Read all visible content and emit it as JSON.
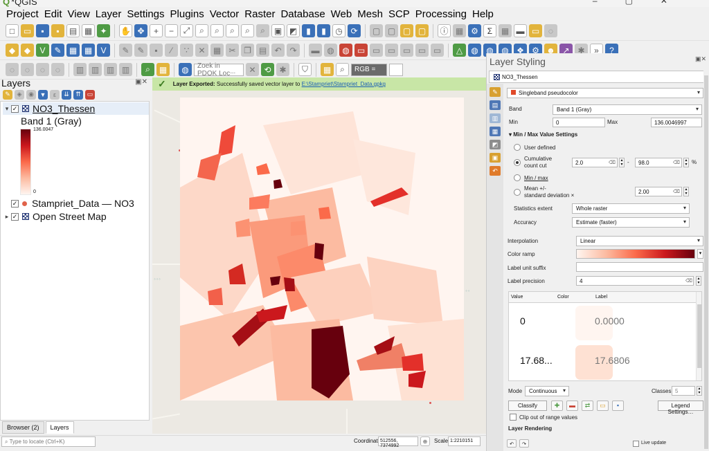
{
  "window": {
    "title": "*QGIS"
  },
  "menu": [
    "Project",
    "Edit",
    "View",
    "Layer",
    "Settings",
    "Plugins",
    "Vector",
    "Raster",
    "Database",
    "Web",
    "Mesh",
    "SCP",
    "Processing",
    "Help"
  ],
  "toolbar": {
    "pdok_placeholder": "Zoek in PDOK Locᐧᐧᐧ",
    "rgb_label": "RGB ="
  },
  "layers_panel": {
    "title": "Layers",
    "items": [
      {
        "label": "NO3_Thessen",
        "checked": "✓"
      },
      {
        "label": "Stampriet_Data — NO3",
        "checked": "✓"
      },
      {
        "label": "Open Street Map",
        "checked": "✓"
      }
    ],
    "legend": {
      "band": "Band 1 (Gray)",
      "max": "136.0047",
      "min": "0"
    }
  },
  "message": {
    "bold": "Layer Exported:",
    "text": "Successfully saved vector layer to",
    "link": "E:\\Stampriet\\Stampriet_Data.gpkg"
  },
  "bottom_tabs": [
    "Browser (2)",
    "Layers"
  ],
  "status": {
    "locate_placeholder": "Type to locate (Ctrl+K)",
    "coord_label": "Coordinate",
    "coord_value": "512556, 7374992",
    "scale_label": "Scale",
    "scale_value": "1:2210151"
  },
  "styling": {
    "title": "Layer Styling",
    "layer": "NO3_Thessen",
    "renderer": "Singleband pseudocolor",
    "band_label": "Band",
    "band_value": "Band 1 (Gray)",
    "min_label": "Min",
    "min_value": "0",
    "max_label": "Max",
    "max_value": "136.0046997",
    "minmax_title": "Min / Max Value Settings",
    "user_defined": "User defined",
    "cumulative": "Cumulative\ncount cut",
    "cum_low": "2.0",
    "cum_high": "98.0",
    "cum_unit": "%",
    "minmax": "Min / max",
    "meansd": "Mean +/-\nstandard deviation ×",
    "meansd_value": "2.00",
    "stats_extent_label": "Statistics extent",
    "stats_extent_value": "Whole raster",
    "accuracy_label": "Accuracy",
    "accuracy_value": "Estimate (faster)",
    "interp_label": "Interpolation",
    "interp_value": "Linear",
    "ramp_label": "Color ramp",
    "suffix_label": "Label unit suffix",
    "precision_label": "Label precision",
    "precision_value": "4",
    "table_headers": [
      "Value",
      "Color",
      "Label"
    ],
    "table_rows": [
      {
        "value": "0",
        "color": "#fff5f0",
        "label": "0.0000"
      },
      {
        "value": "17.68...",
        "color": "#fee1d3",
        "label": "17.6806"
      }
    ],
    "mode_label": "Mode",
    "mode_value": "Continuous",
    "classes_label": "Classes",
    "classes_value": "5",
    "classify": "Classify",
    "legend_settings": "Legend Settings…",
    "clip_label": "Clip out of range values",
    "rendering": "Layer Rendering",
    "live_update": "Live update"
  }
}
